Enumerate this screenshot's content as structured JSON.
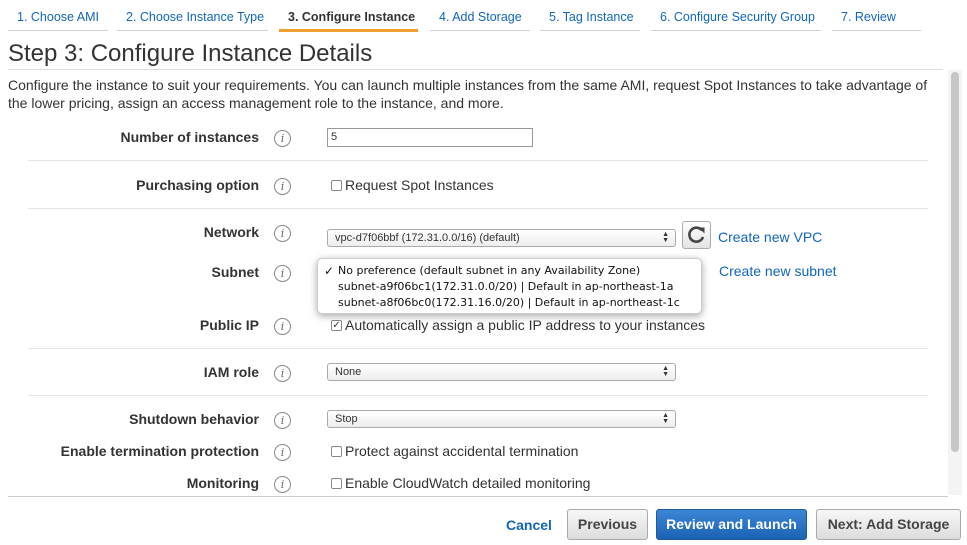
{
  "wizard_tabs": [
    {
      "label": "1. Choose AMI"
    },
    {
      "label": "2. Choose Instance Type"
    },
    {
      "label": "3. Configure Instance"
    },
    {
      "label": "4. Add Storage"
    },
    {
      "label": "5. Tag Instance"
    },
    {
      "label": "6. Configure Security Group"
    },
    {
      "label": "7. Review"
    }
  ],
  "active_tab_index": 2,
  "page": {
    "title": "Step 3: Configure Instance Details",
    "description": "Configure the instance to suit your requirements. You can launch multiple instances from the same AMI, request Spot Instances to take advantage of the lower pricing, assign an access management role to the instance, and more."
  },
  "info_icon_glyph": "i",
  "form": {
    "instances": {
      "label": "Number of instances",
      "value": "5"
    },
    "purchasing": {
      "label": "Purchasing option",
      "checkbox_label": "Request Spot Instances",
      "checked": false
    },
    "network": {
      "label": "Network",
      "value": "vpc-d7f06bbf (172.31.0.0/16) (default)",
      "link": "Create new VPC"
    },
    "subnet": {
      "label": "Subnet",
      "link": "Create new subnet",
      "options": [
        "No preference (default subnet in any Availability Zone)",
        "subnet-a9f06bc1(172.31.0.0/20) | Default in ap-northeast-1a",
        "subnet-a8f06bc0(172.31.16.0/20) | Default in ap-northeast-1c"
      ],
      "selected_index": 0
    },
    "public_ip": {
      "label": "Public IP",
      "checkbox_label": "Automatically assign a public IP address to your instances",
      "checked": true
    },
    "iam_role": {
      "label": "IAM role",
      "value": "None"
    },
    "shutdown": {
      "label": "Shutdown behavior",
      "value": "Stop"
    },
    "termination": {
      "label": "Enable termination protection",
      "checkbox_label": "Protect against accidental termination",
      "checked": false
    },
    "monitoring": {
      "label": "Monitoring",
      "checkbox_label": "Enable CloudWatch detailed monitoring",
      "checked": false
    }
  },
  "footer": {
    "cancel": "Cancel",
    "previous": "Previous",
    "review_launch": "Review and Launch",
    "next": "Next: Add Storage"
  },
  "colors": {
    "accent_tab": "#f0a030",
    "link": "#1166bb",
    "primary_button": "#2a72c6"
  },
  "icons": {
    "refresh": "refresh-icon",
    "info": "info-icon",
    "checkmark": "checkmark-icon"
  }
}
